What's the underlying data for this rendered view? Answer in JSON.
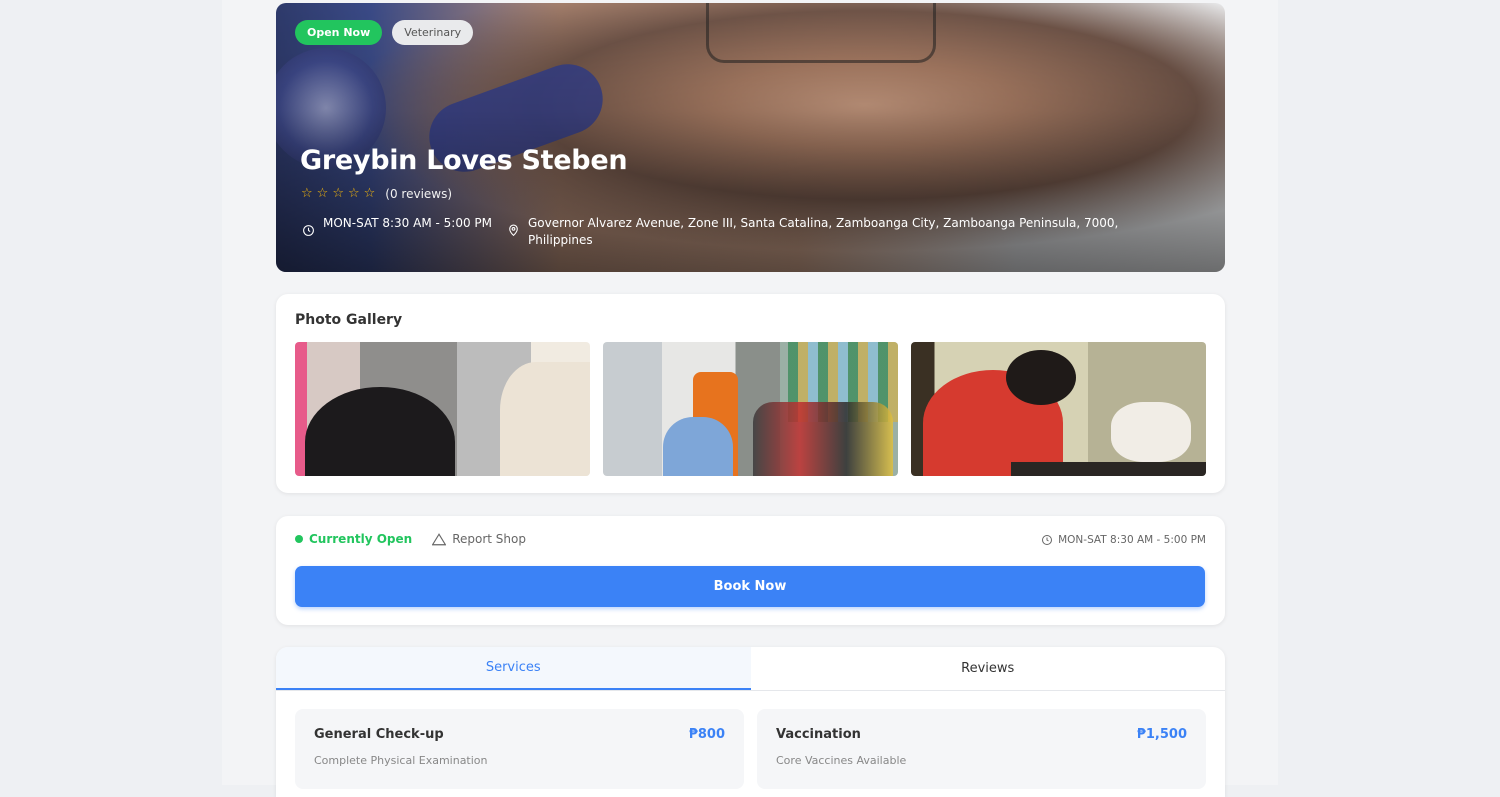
{
  "hero": {
    "badges": {
      "status": "Open Now",
      "category": "Veterinary"
    },
    "title": "Greybin Loves Steben",
    "rating": {
      "stars": 0,
      "max": 5,
      "reviews_text": "(0 reviews)"
    },
    "hours": "MON-SAT 8:30 AM - 5:00 PM",
    "address": "Governor Alvarez Avenue, Zone III, Santa Catalina, Zamboanga City, Zamboanga Peninsula, 7000, Philippines"
  },
  "gallery": {
    "title": "Photo Gallery"
  },
  "action": {
    "status": "Currently Open",
    "report": "Report Shop",
    "hours": "MON-SAT 8:30 AM - 5:00 PM",
    "book_label": "Book Now"
  },
  "tabs": [
    {
      "label": "Services",
      "active": true
    },
    {
      "label": "Reviews",
      "active": false
    }
  ],
  "services": [
    {
      "name": "General Check-up",
      "price": "₱800",
      "desc": "Complete Physical Examination"
    },
    {
      "name": "Vaccination",
      "price": "₱1,500",
      "desc": "Core Vaccines Available"
    }
  ],
  "colors": {
    "accent": "#3b82f6",
    "open_green": "#22c55e",
    "star": "#f5b70a"
  }
}
